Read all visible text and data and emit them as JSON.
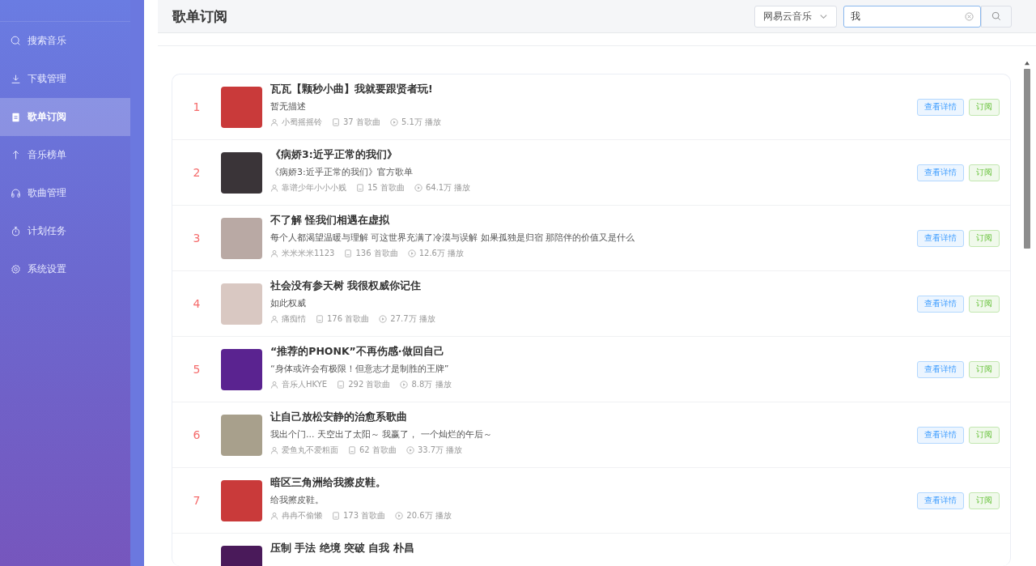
{
  "sidebar": {
    "items": [
      {
        "label": "搜索音乐",
        "selected": false
      },
      {
        "label": "下载管理",
        "selected": false
      },
      {
        "label": "歌单订阅",
        "selected": true
      },
      {
        "label": "音乐榜单",
        "selected": false
      },
      {
        "label": "歌曲管理",
        "selected": false
      },
      {
        "label": "计划任务",
        "selected": false
      },
      {
        "label": "系统设置",
        "selected": false
      }
    ]
  },
  "header": {
    "title": "歌单订阅",
    "source": "网易云音乐",
    "search": "我"
  },
  "playlists": [
    {
      "rank": "1",
      "title": "瓦瓦【颗秒小曲】我就要跟贤者玩!",
      "description": "暂无描述",
      "creator": "小蜀摇摇铃",
      "songs": "37 首歌曲",
      "plays": "5.1万 播放",
      "detail": "查看详情",
      "subscribe": "订阅"
    },
    {
      "rank": "2",
      "title": "《病娇3:近乎正常的我们》",
      "description": "《病娇3:近乎正常的我们》官方歌单",
      "creator": "靠谱少年小小小贱",
      "songs": "15 首歌曲",
      "plays": "64.1万 播放",
      "detail": "查看详情",
      "subscribe": "订阅"
    },
    {
      "rank": "3",
      "title": "不了解 怪我们相遇在虚拟",
      "description": "每个人都渴望温暖与理解 可这世界充满了冷漠与误解 如果孤独是归宿 那陪伴的价值又是什么",
      "creator": "米米米米1123",
      "songs": "136 首歌曲",
      "plays": "12.6万 播放",
      "detail": "查看详情",
      "subscribe": "订阅"
    },
    {
      "rank": "4",
      "title": "社会没有参天树 我很权威你记住",
      "description": "如此权威",
      "creator": "痛痴情",
      "songs": "176 首歌曲",
      "plays": "27.7万 播放",
      "detail": "查看详情",
      "subscribe": "订阅"
    },
    {
      "rank": "5",
      "title": "“推荐的PHONK”不再伤感·做回自己",
      "description": "“身体或许会有极限！但意志才是制胜的王牌”",
      "creator": "音乐人HKYE",
      "songs": "292 首歌曲",
      "plays": "8.8万 播放",
      "detail": "查看详情",
      "subscribe": "订阅"
    },
    {
      "rank": "6",
      "title": "让自己放松安静的治愈系歌曲",
      "description": "我出个门... 天空出了太阳～ 我赢了， 一个灿烂的午后～",
      "creator": "爱鱼丸不爱粗面",
      "songs": "62 首歌曲",
      "plays": "33.7万 播放",
      "detail": "查看详情",
      "subscribe": "订阅"
    },
    {
      "rank": "7",
      "title": "暗区三角洲给我擦皮鞋。",
      "description": "给我擦皮鞋。",
      "creator": "冉冉不偷懒",
      "songs": "173 首歌曲",
      "plays": "20.6万 播放",
      "detail": "查看详情",
      "subscribe": "订阅"
    },
    {
      "title": "压制 手法 绝境 突破 自我 朴昌"
    }
  ]
}
